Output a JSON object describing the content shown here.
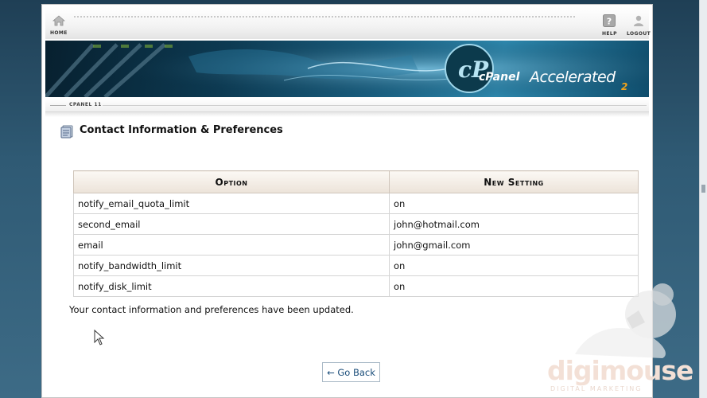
{
  "toolbar": {
    "home_label": "HOME",
    "help_label": "HELP",
    "logout_label": "LOGOUT"
  },
  "banner": {
    "logo_text": "cPanel",
    "logo_suffix": "Accelerated",
    "logo_version": "2"
  },
  "tabbar": {
    "label": "CPANEL 11"
  },
  "page": {
    "title": "Contact Information & Preferences"
  },
  "table": {
    "headers": [
      "Option",
      "New Setting"
    ],
    "rows": [
      {
        "option": "notify_email_quota_limit",
        "setting": "on"
      },
      {
        "option": "second_email",
        "setting": "john@hotmail.com"
      },
      {
        "option": "email",
        "setting": "john@gmail.com"
      },
      {
        "option": "notify_bandwidth_limit",
        "setting": "on"
      },
      {
        "option": "notify_disk_limit",
        "setting": "on"
      }
    ]
  },
  "status_message": "Your contact information and preferences have been updated.",
  "back_button": {
    "label": "← Go Back"
  },
  "watermark": {
    "text": "digimouse",
    "subtext": "DIGITAL MARKETING"
  }
}
